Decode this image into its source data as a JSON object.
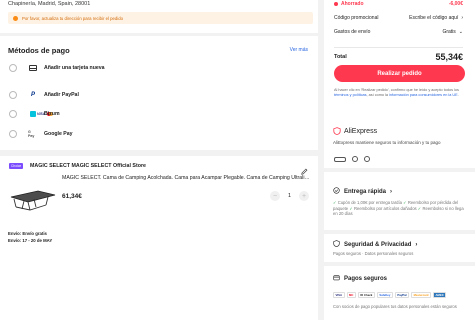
{
  "address": {
    "line": "Chapinería, Madrid, Spain, 28001",
    "warning": "Por favor, actualiza tu dirección para recibir el pedido"
  },
  "payment": {
    "title": "Métodos de pago",
    "more": "Ver más",
    "methods": [
      {
        "label": "Añadir una tarjeta nueva",
        "icon": "credit-card-icon"
      },
      {
        "label": "Añadir PayPal",
        "icon": "paypal-icon"
      },
      {
        "label": "Bizum",
        "icon": "bizum-icon"
      },
      {
        "label": "Google Pay",
        "icon": "google-pay-icon"
      }
    ],
    "visa": "VISA",
    "gpay_mark": "G Pay"
  },
  "store": {
    "badge": "Choice",
    "name": "MAGIC SELECT MAGIC SELECT Official Store",
    "product_title": "MAGIC SELECT. Cama de Camping Acolchada. Cama para Acampar Plegable. Cama de Camping Ultraligera",
    "price": "61,34€",
    "quantity": "1",
    "shipping_line1": "Envío: Envío gratis",
    "shipping_line2": "Envío: 17 - 20 de MAY"
  },
  "summary": {
    "saved_label": "Ahorrado",
    "saved_value": "-6,00€",
    "promo_label": "Código promocional",
    "promo_value": "Escribe el código aquí",
    "shipping_label": "Gastos de envío",
    "shipping_value": "Gratis",
    "total_label": "Total",
    "total_value": "55,34€",
    "order_button": "Realizar pedido",
    "legal_a": "Al hacer clic en 'Realizar pedido', confirmo que he leído y acepto todos los ",
    "legal_link1": "términos y políticas",
    "legal_b": ", así como la ",
    "legal_link2": "información para consumidores en la UE",
    "legal_c": "."
  },
  "trust": {
    "brand": "AliExpress",
    "text": "AliExpress mantiene seguros tu información y tu pago",
    "fast_title": "Entrega rápida",
    "fast_i1": "Cupón de 1,00€ por entrega tardía",
    "fast_i2": "Reembolso por pérdida del paquete",
    "fast_i3": "Reembolso por artículos dañados",
    "fast_i4": "Reembolso si no llega en 20 días",
    "privacy_title": "Seguridad & Privacidad",
    "privacy_body": "Pagos seguros · Datos personales seguros",
    "secure_title": "Pagos seguros",
    "secure_body": "Con socios de pago populares tus datos personales están seguros",
    "pay_logos": [
      "VISA",
      "MC",
      "ID Check",
      "SafeKey",
      "PayPal",
      "Mastercard",
      "AMEX"
    ]
  },
  "colors": {
    "accent": "#fd384f",
    "link": "#2866e0",
    "warning_bg": "#fdf2e4",
    "warning_text": "#d46b08",
    "success": "#1a9e3e"
  }
}
